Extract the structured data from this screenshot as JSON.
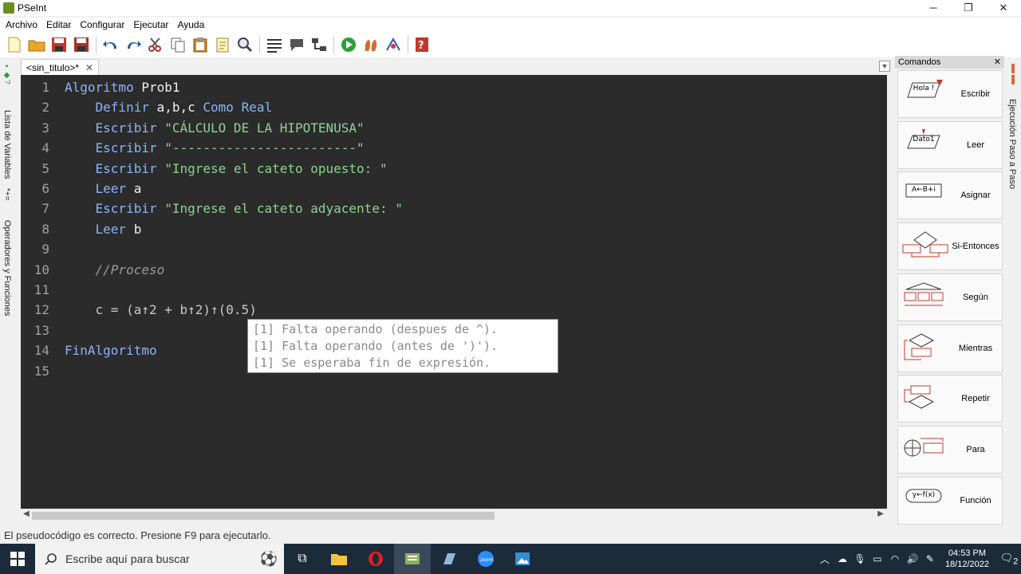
{
  "window": {
    "title": "PSeInt",
    "minimize": "─",
    "maximize": "❐",
    "close": "✕"
  },
  "menu": [
    "Archivo",
    "Editar",
    "Configurar",
    "Ejecutar",
    "Ayuda"
  ],
  "left_panel": {
    "variables": "Lista de Variables",
    "operators": "Operadores y Funciones"
  },
  "right_panel": {
    "step": "Ejecución Paso a Paso"
  },
  "tab": {
    "label": "<sin_titulo>*",
    "close": "✕"
  },
  "editor": {
    "lines": [
      {
        "n": "1",
        "parts": [
          {
            "t": "Algoritmo",
            "c": "kw"
          },
          {
            "t": " Prob1",
            "c": "id"
          }
        ]
      },
      {
        "n": "2",
        "parts": [
          {
            "t": "    Definir",
            "c": "kw"
          },
          {
            "t": " a,b,c ",
            "c": "id"
          },
          {
            "t": "Como Real",
            "c": "kw"
          }
        ]
      },
      {
        "n": "3",
        "parts": [
          {
            "t": "    Escribir",
            "c": "kw"
          },
          {
            "t": " \"CÁLCULO DE LA HIPOTENUSA\"",
            "c": "str"
          }
        ]
      },
      {
        "n": "4",
        "parts": [
          {
            "t": "    Escribir",
            "c": "kw"
          },
          {
            "t": " \"------------------------\"",
            "c": "str"
          }
        ]
      },
      {
        "n": "5",
        "parts": [
          {
            "t": "    Escribir",
            "c": "kw"
          },
          {
            "t": " \"Ingrese el cateto opuesto: \"",
            "c": "str"
          }
        ]
      },
      {
        "n": "6",
        "parts": [
          {
            "t": "    Leer",
            "c": "kw"
          },
          {
            "t": " a",
            "c": "id"
          }
        ]
      },
      {
        "n": "7",
        "parts": [
          {
            "t": "    Escribir",
            "c": "kw"
          },
          {
            "t": " \"Ingrese el cateto adyacente: \"",
            "c": "str"
          }
        ]
      },
      {
        "n": "8",
        "parts": [
          {
            "t": "    Leer",
            "c": "kw"
          },
          {
            "t": " b",
            "c": "id"
          }
        ]
      },
      {
        "n": "9",
        "parts": []
      },
      {
        "n": "10",
        "parts": [
          {
            "t": "    //Proceso",
            "c": "cm"
          }
        ]
      },
      {
        "n": "11",
        "parts": []
      },
      {
        "n": "12",
        "parts": [
          {
            "t": "    c = (a↑2 + b↑2)↑(0.5)",
            "c": "op"
          }
        ]
      },
      {
        "n": "13",
        "parts": []
      },
      {
        "n": "14",
        "parts": [
          {
            "t": "FinAlgoritmo",
            "c": "kw"
          }
        ]
      },
      {
        "n": "15",
        "parts": []
      }
    ]
  },
  "error_popup": [
    "[1] Falta operando (despues de ^).",
    "[1] Falta operando (antes de ')').",
    "[1] Se esperaba fin de expresión."
  ],
  "commands": {
    "title": "Comandos",
    "close": "✕",
    "items": [
      {
        "label": "Escribir",
        "icon_text": "Hola !"
      },
      {
        "label": "Leer",
        "icon_text": "Dato1"
      },
      {
        "label": "Asignar",
        "icon_text": "A←B+i"
      },
      {
        "label": "Si-Entonces",
        "icon_text": ""
      },
      {
        "label": "Según",
        "icon_text": ""
      },
      {
        "label": "Mientras",
        "icon_text": ""
      },
      {
        "label": "Repetir",
        "icon_text": ""
      },
      {
        "label": "Para",
        "icon_text": ""
      },
      {
        "label": "Función",
        "icon_text": "y←f(x)"
      }
    ]
  },
  "status_bar": "El pseudocódigo es correcto. Presione F9 para ejecutarlo.",
  "taskbar": {
    "search_placeholder": "Escribe aquí para buscar",
    "time": "04:53 PM",
    "date": "18/12/2022",
    "notifications": "2"
  }
}
